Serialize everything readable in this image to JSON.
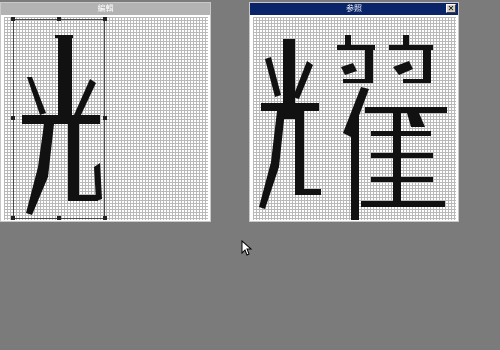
{
  "edit_window": {
    "title": "編輯",
    "glyph_char": "光"
  },
  "ref_window": {
    "title": "参照",
    "close_label": "✕",
    "glyph_char": "耀"
  },
  "icons": {
    "cursor": "mouse-pointer-icon",
    "close": "close-icon"
  },
  "colors": {
    "desktop": "#7b7b7b",
    "active_title": "#0a246a",
    "inactive_title": "#b3b3b3",
    "pixel": "#111111"
  }
}
